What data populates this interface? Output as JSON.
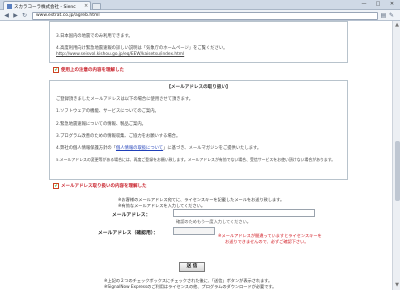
{
  "browser": {
    "tab_title": "スカラコーラ株式会社 - Sienc",
    "tab_close": "×",
    "address": "www.estrat.co.jp/agreb.html",
    "back": "◀",
    "forward": "▶",
    "reload": "↻",
    "minimize": "—",
    "maximize": "□",
    "close": "✕"
  },
  "box1": {
    "lines": [
      "3.日本国内の地震でのみ利用できます。",
      "4.高度利用向け緊急地震速報の詳しい説明は「気象庁のホームページ」をご覧ください。"
    ],
    "link": "http://www.seisvol.kishou.go.jp/eq/EEW/kaisetsu/index.html"
  },
  "check1": {
    "mark": "✔",
    "label": "使用上の注意の内容を理解した"
  },
  "box2": {
    "heading": "【メールアドレスの取り扱い】",
    "lines": [
      "ご登録頂きましたメールアドレスは以下の場合に使用させて頂きます。",
      "1.ソフトウェアの機能、サービスについてのご案内。",
      "2.緊急地震速報についての情報、製品ご案内。",
      "3.プログラム改善のための情報収集、ご協力をお願いする場合。",
      "4.弊社の個人情報保護方針の「",
      "5.メールアドレスの変更等がある場合には、再度ご登録をお願い致します。メールアドレスが有効でない場合、受信サービスをお使い頂けない場合があります。"
    ],
    "line4_link": "個人情報の取扱について",
    "line4_tail": "」に基づき、メールマガジンをご提供いたします。"
  },
  "check2": {
    "mark": "✔",
    "label": "メールアドレス取り扱いの内容を理解した"
  },
  "form": {
    "note1": "※お客様のメールアドレス宛てに、ライセンスキーを記載したメールをお送り致します。",
    "note2": "※有効なメールアドレスを入力してください。",
    "email_label": "メールアドレス：",
    "email_value": "",
    "confirm_label": "メールアドレス（確認用）：",
    "confirm_value": "",
    "confirm_placeholder": "確認のためもう一度入力してください。",
    "error1": "※メールアドレスが間違っていますとライセンスキーを",
    "error2": "お送りできませんので、必ずご確認下さい。",
    "send_label": "送 信"
  },
  "footer": {
    "line1": "※上記の２つのチェックボックスにチェックされた後に、「送信」ボタンが表示されます。",
    "line2": "※SignalNow Expressのご利用はライセンスの他、プログラムのダウンロードが必要です。"
  }
}
